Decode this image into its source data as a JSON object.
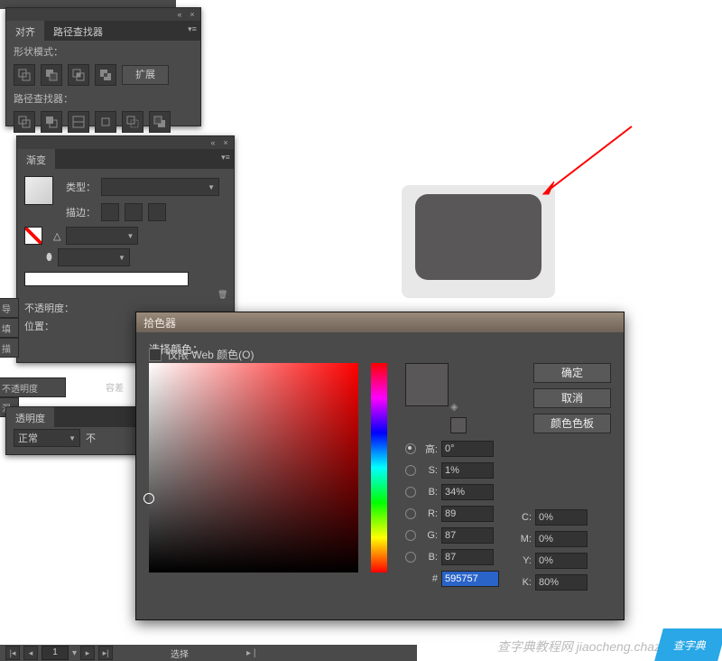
{
  "align_panel": {
    "tab1": "对齐",
    "tab2": "路径查找器",
    "shape_mode_label": "形状模式：",
    "expand_btn": "扩展",
    "pathfinder_label": "路径查找器："
  },
  "gradient_panel": {
    "tab": "渐变",
    "type_label": "类型：",
    "stroke_label": "描边：",
    "angle_icon": "▲",
    "opacity_label": "不透明度：",
    "position_label": "位置："
  },
  "edge_labels": {
    "a": "导",
    "b": "填",
    "c": "描",
    "d": "不透明度",
    "e": "混",
    "f": "透明度",
    "g": "容差"
  },
  "transparency_panel": {
    "mode": "正常",
    "opacity_prefix": "不"
  },
  "color_picker": {
    "title": "拾色器",
    "select_color": "选择颜色：",
    "ok": "确定",
    "cancel": "取消",
    "swatches": "颜色色板",
    "H_lab": "高:",
    "H_val": "0°",
    "S_lab": "S:",
    "S_val": "1%",
    "B_lab": "B:",
    "B_val": "34%",
    "R_lab": "R:",
    "R_val": "89",
    "G_lab": "G:",
    "G_val": "87",
    "Bb_lab": "B:",
    "Bb_val": "87",
    "hex_prefix": "#",
    "hex_val": "595757",
    "C_lab": "C:",
    "C_val": "0%",
    "M_lab": "M:",
    "M_val": "0%",
    "Y_lab": "Y:",
    "Y_val": "0%",
    "K_lab": "K:",
    "K_val": "80%",
    "web_only": "仅限 Web 颜色(O)",
    "preview_color": "#595757"
  },
  "bottombar": {
    "page": "1",
    "select_label": "选择"
  },
  "watermark": "查字典教程网  jiaocheng.chazidian.com",
  "wm_badge": "查字典"
}
